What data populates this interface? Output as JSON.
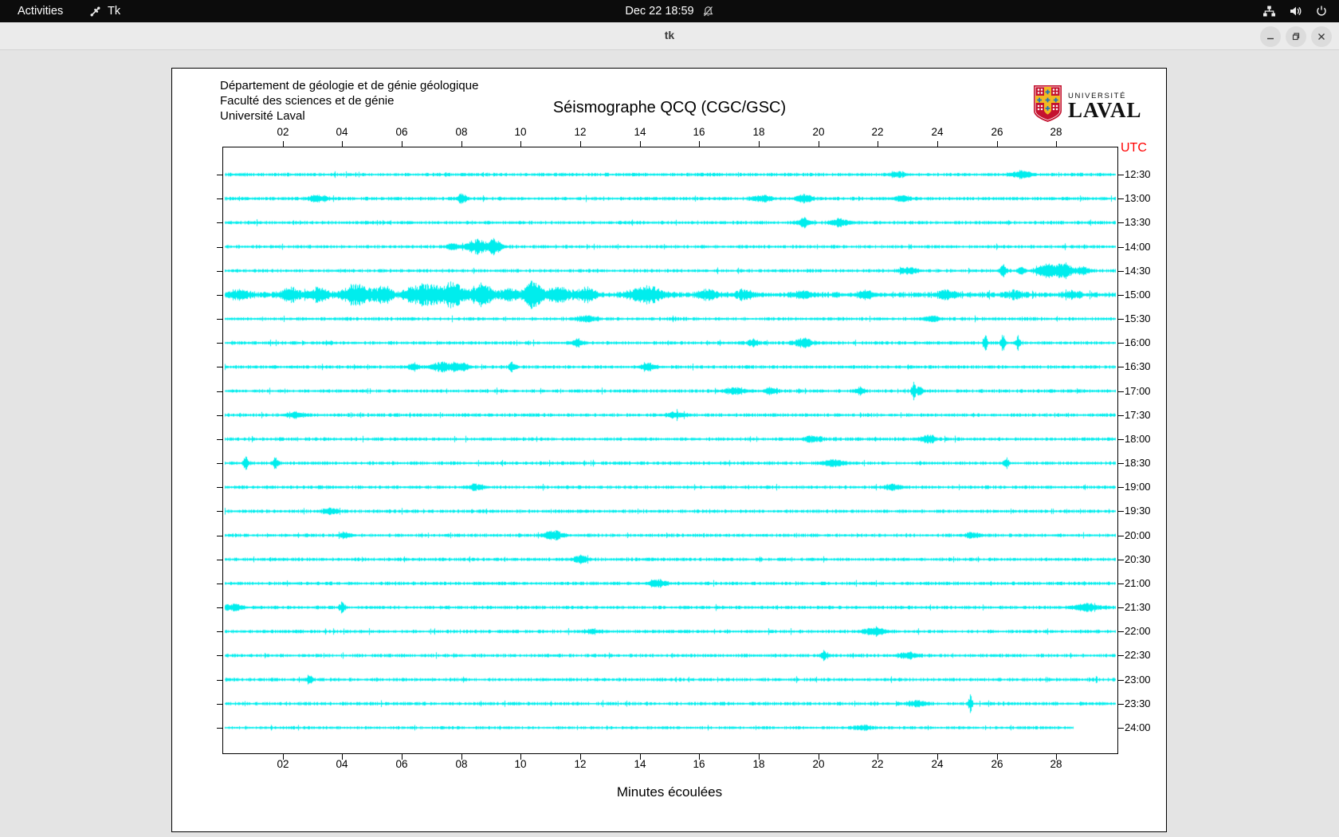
{
  "topbar": {
    "activities": "Activities",
    "app_name": "Tk",
    "clock": "Dec 22  18:59"
  },
  "titlebar": {
    "title": "tk"
  },
  "panel": {
    "org_lines": [
      "Département de géologie et de génie géologique",
      "Faculté des sciences et de génie",
      "Université Laval"
    ],
    "title": "Séismographe QCQ (CGC/GSC)",
    "logo": {
      "small": "UNIVERSITÉ",
      "large": "LAVAL"
    },
    "utc_label": "UTC",
    "xlabel": "Minutes écoulées"
  },
  "chart_data": {
    "type": "line",
    "subtype": "seismogram-helicorder",
    "title": "Séismographe QCQ (CGC/GSC)",
    "xlabel": "Minutes écoulées",
    "x_range": [
      0,
      30
    ],
    "x_ticks": [
      "02",
      "04",
      "06",
      "08",
      "10",
      "12",
      "14",
      "16",
      "18",
      "20",
      "22",
      "24",
      "26",
      "28"
    ],
    "trace_color": "#00eded",
    "background": "#ffffff",
    "rows": [
      {
        "label": "12:30",
        "nf": 1,
        "end": 30,
        "events": [
          [
            22.7,
            0.25,
            3
          ],
          [
            26.8,
            0.3,
            4.5
          ]
        ]
      },
      {
        "label": "13:00",
        "nf": 1,
        "end": 30,
        "events": [
          [
            3.2,
            0.3,
            4
          ],
          [
            8.0,
            0.15,
            6
          ],
          [
            18.1,
            0.3,
            4
          ],
          [
            19.5,
            0.25,
            5
          ],
          [
            22.8,
            0.3,
            3
          ]
        ]
      },
      {
        "label": "13:30",
        "nf": 1,
        "end": 30,
        "events": [
          [
            19.5,
            0.2,
            5
          ],
          [
            20.7,
            0.3,
            4.5
          ]
        ]
      },
      {
        "label": "14:00",
        "nf": 1,
        "end": 30,
        "events": [
          [
            7.7,
            0.2,
            4
          ],
          [
            8.5,
            0.35,
            8
          ],
          [
            9.1,
            0.25,
            9
          ]
        ]
      },
      {
        "label": "14:30",
        "nf": 1,
        "end": 30,
        "events": [
          [
            23.0,
            0.3,
            4
          ],
          [
            26.2,
            0.12,
            8
          ],
          [
            26.8,
            0.12,
            6
          ],
          [
            27.6,
            0.3,
            8
          ],
          [
            28.2,
            0.35,
            9
          ],
          [
            28.9,
            0.15,
            6
          ]
        ]
      },
      {
        "label": "15:00",
        "nf": 1.6,
        "end": 30,
        "events": [
          [
            0.5,
            0.4,
            5
          ],
          [
            2.3,
            0.4,
            7
          ],
          [
            3.2,
            0.3,
            8
          ],
          [
            4.5,
            0.5,
            13
          ],
          [
            5.4,
            0.3,
            10
          ],
          [
            6.5,
            0.4,
            11
          ],
          [
            7.0,
            0.3,
            9
          ],
          [
            7.7,
            0.4,
            15
          ],
          [
            8.7,
            0.4,
            12
          ],
          [
            9.6,
            0.3,
            7
          ],
          [
            10.4,
            0.3,
            17
          ],
          [
            11.3,
            0.4,
            9
          ],
          [
            12.2,
            0.3,
            8
          ],
          [
            14.2,
            0.5,
            11
          ],
          [
            16.3,
            0.3,
            6
          ],
          [
            17.5,
            0.3,
            5
          ],
          [
            19.5,
            0.25,
            5
          ],
          [
            21.6,
            0.3,
            4
          ],
          [
            24.3,
            0.3,
            5
          ],
          [
            26.6,
            0.3,
            4
          ],
          [
            28.5,
            0.25,
            4
          ]
        ]
      },
      {
        "label": "15:30",
        "nf": 1,
        "end": 30,
        "events": [
          [
            12.2,
            0.3,
            4
          ],
          [
            23.8,
            0.25,
            4
          ]
        ]
      },
      {
        "label": "16:00",
        "nf": 1,
        "end": 30,
        "events": [
          [
            11.9,
            0.2,
            4
          ],
          [
            17.8,
            0.15,
            5
          ],
          [
            19.5,
            0.3,
            5
          ],
          [
            25.6,
            0.07,
            10
          ],
          [
            26.2,
            0.07,
            13
          ],
          [
            26.7,
            0.07,
            9
          ]
        ]
      },
      {
        "label": "16:30",
        "nf": 1,
        "end": 30,
        "events": [
          [
            6.4,
            0.2,
            4
          ],
          [
            7.3,
            0.3,
            5
          ],
          [
            7.9,
            0.3,
            6
          ],
          [
            9.7,
            0.1,
            6
          ],
          [
            14.3,
            0.25,
            4
          ]
        ]
      },
      {
        "label": "17:00",
        "nf": 1,
        "end": 30,
        "events": [
          [
            17.2,
            0.35,
            4
          ],
          [
            18.4,
            0.2,
            4
          ],
          [
            21.4,
            0.15,
            4
          ],
          [
            23.2,
            0.08,
            10
          ],
          [
            23.4,
            0.1,
            6
          ]
        ]
      },
      {
        "label": "17:30",
        "nf": 1,
        "end": 30,
        "events": [
          [
            2.4,
            0.3,
            3
          ],
          [
            15.2,
            0.3,
            3.5
          ]
        ]
      },
      {
        "label": "18:00",
        "nf": 1,
        "end": 30,
        "events": [
          [
            19.8,
            0.3,
            3.5
          ],
          [
            23.7,
            0.25,
            4.5
          ]
        ]
      },
      {
        "label": "18:30",
        "nf": 1,
        "end": 30,
        "events": [
          [
            0.75,
            0.08,
            8
          ],
          [
            1.75,
            0.08,
            7
          ],
          [
            20.5,
            0.35,
            4.5
          ],
          [
            26.3,
            0.08,
            7
          ]
        ]
      },
      {
        "label": "19:00",
        "nf": 1,
        "end": 30,
        "events": [
          [
            8.5,
            0.3,
            3
          ],
          [
            22.5,
            0.3,
            3
          ]
        ]
      },
      {
        "label": "19:30",
        "nf": 1,
        "end": 30,
        "events": [
          [
            3.6,
            0.25,
            3.5
          ]
        ]
      },
      {
        "label": "20:00",
        "nf": 1,
        "end": 30,
        "events": [
          [
            4.1,
            0.2,
            3.5
          ],
          [
            11.1,
            0.3,
            6
          ],
          [
            25.2,
            0.25,
            3
          ]
        ]
      },
      {
        "label": "20:30",
        "nf": 1,
        "end": 30,
        "events": [
          [
            12.0,
            0.25,
            4.5
          ]
        ]
      },
      {
        "label": "21:00",
        "nf": 1,
        "end": 30,
        "events": [
          [
            14.6,
            0.3,
            4.5
          ]
        ]
      },
      {
        "label": "21:30",
        "nf": 1,
        "end": 30,
        "events": [
          [
            0.3,
            0.3,
            4
          ],
          [
            4.0,
            0.1,
            6
          ],
          [
            29.0,
            0.4,
            4.5
          ]
        ]
      },
      {
        "label": "22:00",
        "nf": 1,
        "end": 30,
        "events": [
          [
            12.4,
            0.25,
            3
          ],
          [
            21.9,
            0.35,
            5
          ]
        ]
      },
      {
        "label": "22:30",
        "nf": 1,
        "end": 30,
        "events": [
          [
            20.2,
            0.12,
            5
          ],
          [
            23.0,
            0.3,
            3.5
          ]
        ]
      },
      {
        "label": "23:00",
        "nf": 1,
        "end": 30,
        "events": [
          [
            2.9,
            0.1,
            6
          ]
        ]
      },
      {
        "label": "23:30",
        "nf": 1,
        "end": 30,
        "events": [
          [
            23.3,
            0.3,
            3.5
          ],
          [
            25.1,
            0.06,
            12
          ]
        ]
      },
      {
        "label": "24:00",
        "nf": 0.9,
        "end": 28.6,
        "events": [
          [
            21.5,
            0.3,
            3
          ]
        ]
      }
    ]
  },
  "colors": {
    "trace": "#00eded",
    "utc_red": "#ff0000",
    "logo_red": "#c4122f",
    "logo_gold": "#f2b822",
    "logo_blue": "#1b75bb"
  }
}
